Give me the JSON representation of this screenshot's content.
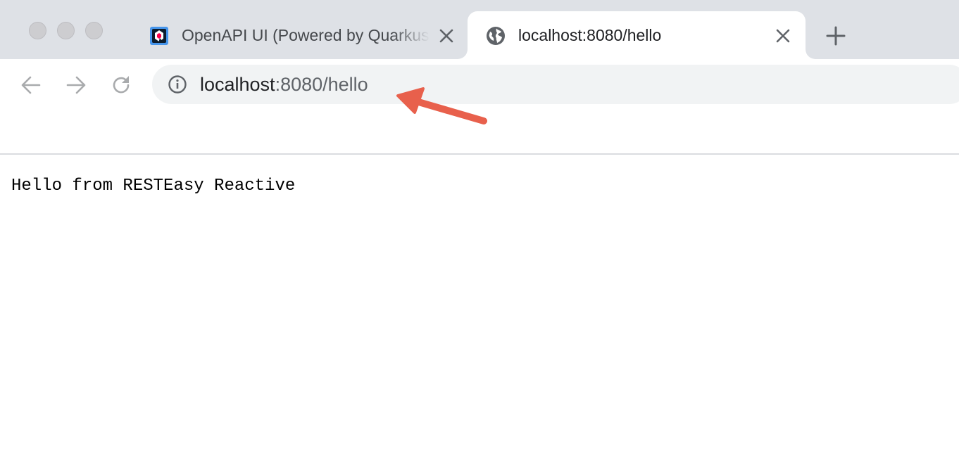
{
  "tabs": [
    {
      "title": "OpenAPI UI (Powered by Quarkus)",
      "favicon": "quarkus-logo-icon",
      "active": false
    },
    {
      "title": "localhost:8080/hello",
      "favicon": "globe-icon",
      "active": true
    }
  ],
  "window_controls": [
    "close",
    "minimize",
    "maximize"
  ],
  "toolbar": {
    "back_icon": "arrow-left-icon",
    "forward_icon": "arrow-right-icon",
    "reload_icon": "reload-icon",
    "site_info_icon": "info-icon",
    "url_host": "localhost",
    "url_rest": ":8080/hello"
  },
  "annotation": {
    "type": "arrow",
    "color": "#e8604c",
    "points_to": "address-bar-url"
  },
  "page": {
    "body_text": "Hello from RESTEasy Reactive"
  },
  "colors": {
    "tabstrip": "#dee1e6",
    "omnibox": "#f1f3f4",
    "annotation": "#e8604c",
    "quarkus_blue": "#4695eb"
  }
}
